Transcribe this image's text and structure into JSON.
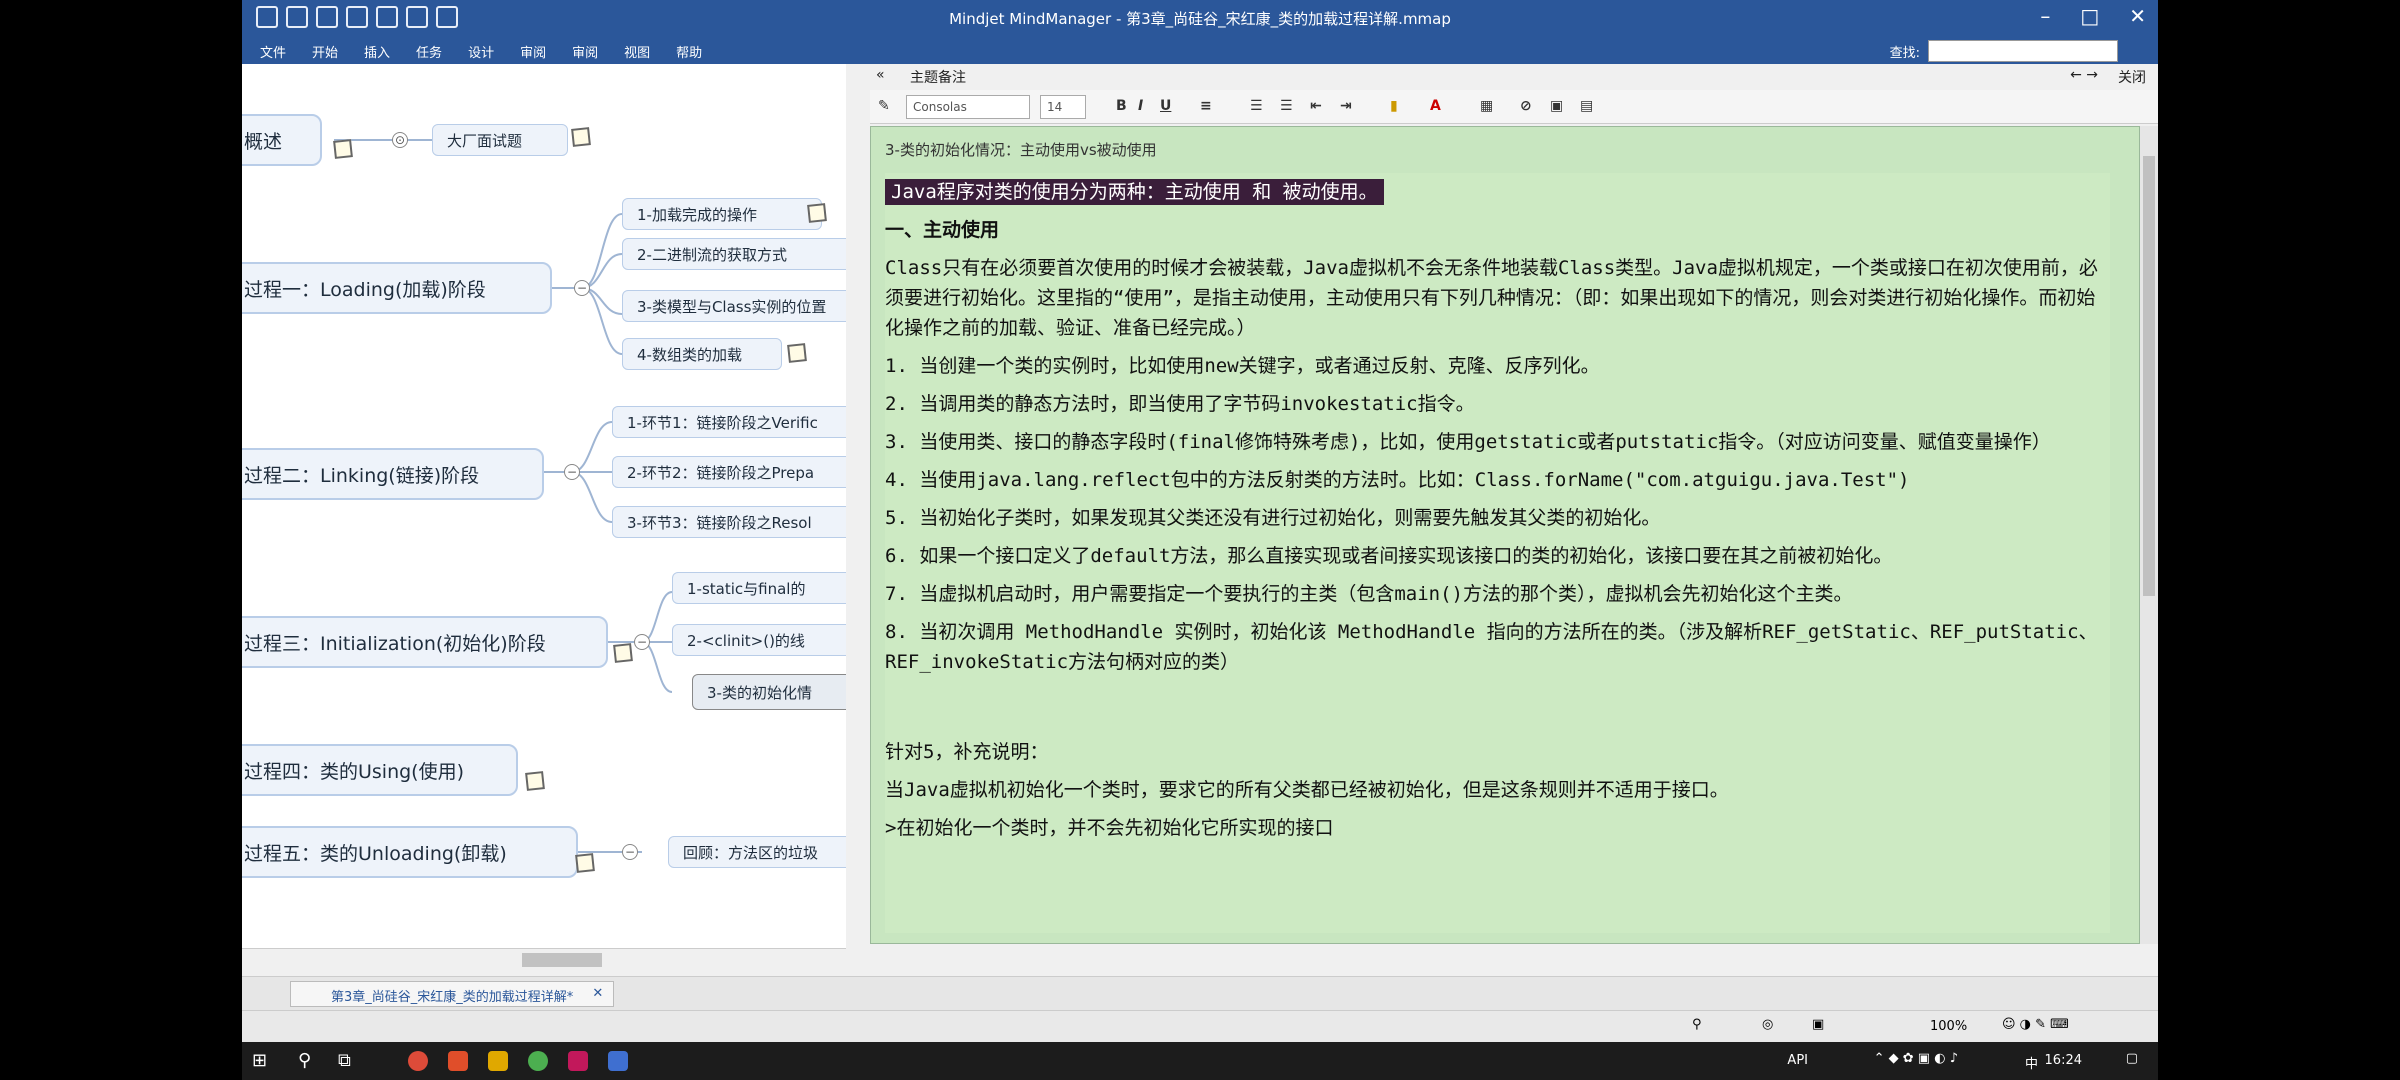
{
  "window": {
    "title": "Mindjet MindManager - 第3章_尚硅谷_宋红康_类的加载过程详解.mmap"
  },
  "menu": {
    "items": [
      "文件",
      "开始",
      "插入",
      "任务",
      "设计",
      "审阅",
      "审阅",
      "视图",
      "帮助"
    ],
    "find_label": "查找:"
  },
  "map": {
    "nodes": [
      {
        "label": "概述"
      },
      {
        "label": "大厂面试题"
      },
      {
        "label": "过程一：Loading(加载)阶段"
      },
      {
        "label": "1-加载完成的操作"
      },
      {
        "label": "2-二进制流的获取方式"
      },
      {
        "label": "3-类模型与Class实例的位置"
      },
      {
        "label": "4-数组类的加载"
      },
      {
        "label": "过程二：Linking(链接)阶段"
      },
      {
        "label": "1-环节1：链接阶段之Verific"
      },
      {
        "label": "2-环节2：链接阶段之Prepa"
      },
      {
        "label": "3-环节3：链接阶段之Resol"
      },
      {
        "label": "过程三：Initialization(初始化)阶段"
      },
      {
        "label": "1-static与final的"
      },
      {
        "label": "2-<clinit>()的线"
      },
      {
        "label": "3-类的初始化情"
      },
      {
        "label": "过程四：类的Using(使用)"
      },
      {
        "label": "过程五：类的Unloading(卸载)"
      },
      {
        "label": "回顾：方法区的垃圾"
      }
    ]
  },
  "notes": {
    "header": "主题备注",
    "close_label": "关闭",
    "font_name": "Consolas",
    "font_size": "14",
    "topic_title": "3-类的初始化情况：主动使用vs被动使用",
    "paragraphs": [
      "Java程序对类的使用分为两种：主动使用 和 被动使用。",
      "一、主动使用",
      "Class只有在必须要首次使用的时候才会被装载，Java虚拟机不会无条件地装载Class类型。Java虚拟机规定，一个类或接口在初次使用前，必须要进行初始化。这里指的“使用”，是指主动使用，主动使用只有下列几种情况：（即：如果出现如下的情况，则会对类进行初始化操作。而初始化操作之前的加载、验证、准备已经完成。）",
      "1. 当创建一个类的实例时，比如使用new关键字，或者通过反射、克隆、反序列化。",
      "2. 当调用类的静态方法时，即当使用了字节码invokestatic指令。",
      "3. 当使用类、接口的静态字段时(final修饰特殊考虑)，比如，使用getstatic或者putstatic指令。（对应访问变量、赋值变量操作）",
      "4. 当使用java.lang.reflect包中的方法反射类的方法时。比如：Class.forName(\"com.atguigu.java.Test\")",
      "5. 当初始化子类时，如果发现其父类还没有进行过初始化，则需要先触发其父类的初始化。",
      "6. 如果一个接口定义了default方法，那么直接实现或者间接实现该接口的类的初始化，该接口要在其之前被初始化。",
      "7. 当虚拟机启动时，用户需要指定一个要执行的主类（包含main()方法的那个类），虚拟机会先初始化这个主类。",
      "8. 当初次调用 MethodHandle 实例时，初始化该 MethodHandle 指向的方法所在的类。（涉及解析REF_getStatic、REF_putStatic、REF_invokeStatic方法句柄对应的类）",
      "针对5，补充说明：",
      "当Java虚拟机初始化一个类时，要求它的所有父类都已经被初始化，但是这条规则并不适用于接口。",
      ">在初始化一个类时，并不会先初始化它所实现的接口"
    ]
  },
  "doc_tab": {
    "label": "第3章_尚硅谷_宋红康_类的加载过程详解*"
  },
  "status": {
    "zoom": "100%"
  },
  "taskbar": {
    "api": "API",
    "lang": "中",
    "clock": "16:24"
  }
}
